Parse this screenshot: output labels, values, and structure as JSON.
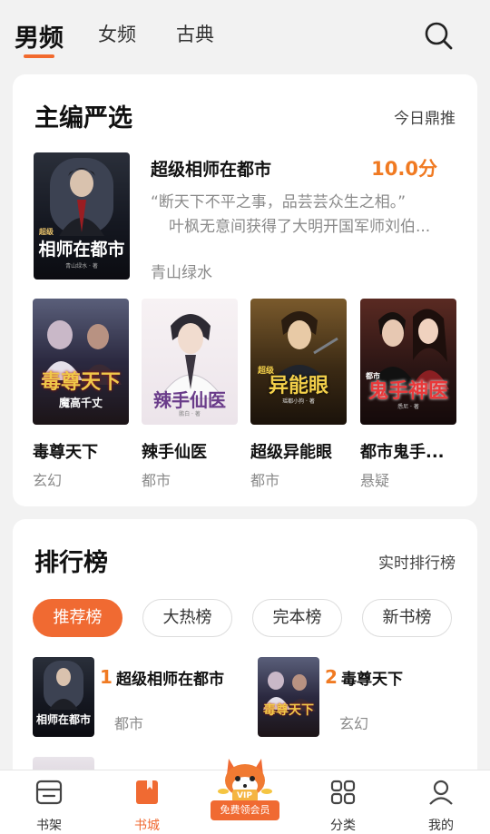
{
  "top_tabs": [
    {
      "label": "男频",
      "active": true
    },
    {
      "label": "女频",
      "active": false
    },
    {
      "label": "古典",
      "active": false
    }
  ],
  "accent_color": "#f06a32",
  "editor_pick": {
    "title": "主编严选",
    "link": "今日鼎推",
    "featured": {
      "cover_text": "相师在都市",
      "cover_badge": "超级",
      "cover_author": "青山绿水 · 著",
      "title": "超级相师在都市",
      "score": "10.0分",
      "desc_line1": "“断天下不平之事，品芸芸众生之相。”",
      "desc_line2": "叶枫无意间获得了大明开国军师刘伯...",
      "author": "青山绿水"
    },
    "books": [
      {
        "title": "毒尊天下",
        "category": "玄幻",
        "cover_text": "毒尊天下",
        "cover_author": "魔高千丈"
      },
      {
        "title": "辣手仙医",
        "category": "都市",
        "cover_text": "辣手仙医",
        "cover_author": "鹏白 · 著"
      },
      {
        "title": "超级异能眼",
        "category": "都市",
        "cover_text": "异能眼",
        "cover_badge": "超级",
        "cover_author": "瑶都小狗 · 著"
      },
      {
        "title": "都市鬼手...",
        "category": "悬疑",
        "cover_text": "鬼手神医",
        "cover_badge": "都市",
        "cover_author": "悉尼 · 著"
      }
    ]
  },
  "ranking": {
    "title": "排行榜",
    "link": "实时排行榜",
    "tabs": [
      {
        "label": "推荐榜",
        "active": true
      },
      {
        "label": "大热榜",
        "active": false
      },
      {
        "label": "完本榜",
        "active": false
      },
      {
        "label": "新书榜",
        "active": false
      }
    ],
    "items": [
      {
        "rank": "1",
        "title": "超级相师在都市",
        "category": "都市",
        "cover_text": "相师在都市"
      },
      {
        "rank": "2",
        "title": "毒尊天下",
        "category": "玄幻",
        "cover_text": "毒尊天下"
      }
    ]
  },
  "bottom_nav": [
    {
      "label": "书架",
      "icon": "bookshelf-icon",
      "active": false
    },
    {
      "label": "书城",
      "icon": "bookstore-icon",
      "active": true
    },
    {
      "label": "分类",
      "icon": "category-grid-icon",
      "active": false
    },
    {
      "label": "我的",
      "icon": "profile-icon",
      "active": false
    }
  ],
  "vip_button": "免费领会员",
  "vip_badge": "VIP"
}
